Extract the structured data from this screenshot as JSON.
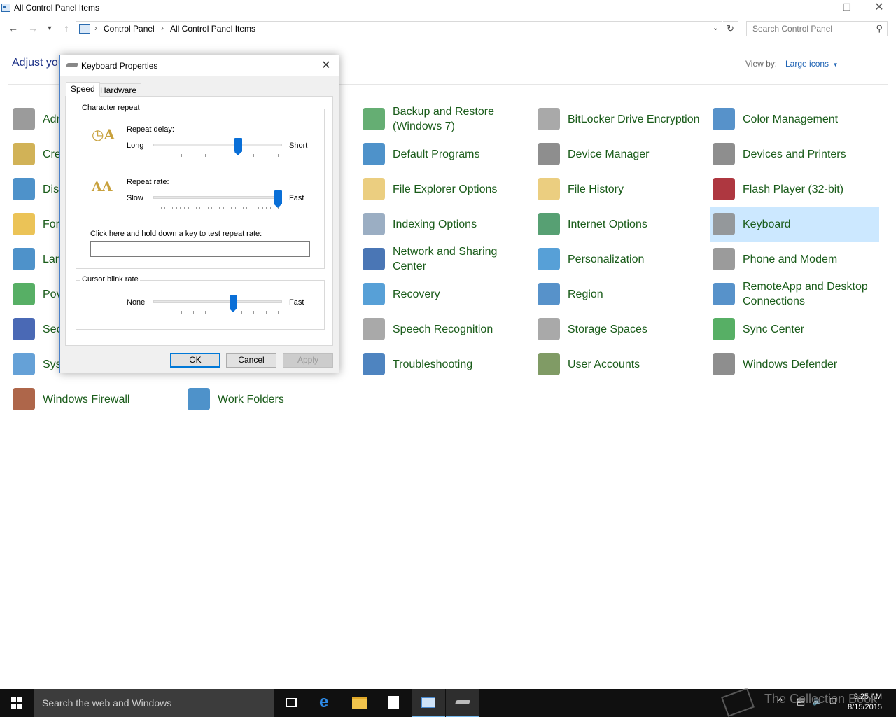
{
  "window": {
    "title": "All Control Panel Items"
  },
  "address": {
    "crumbs": [
      "Control Panel",
      "All Control Panel Items"
    ],
    "search_placeholder": "Search Control Panel"
  },
  "header": {
    "heading_visible": "Adjust you",
    "view_by_label": "View by:",
    "view_by_value": "Large icons"
  },
  "items": [
    {
      "label": "Adr",
      "icon": "administrative-tools-icon",
      "color": "#8a8a8a"
    },
    {
      "label": "Cre",
      "icon": "credential-manager-icon",
      "color": "#c9a43a"
    },
    {
      "label": "Dis",
      "icon": "display-icon",
      "color": "#2f7fc1"
    },
    {
      "label": "For",
      "icon": "fonts-icon",
      "color": "#e8b93a"
    },
    {
      "label": "Lan",
      "icon": "language-icon",
      "color": "#2f7fc1"
    },
    {
      "label": "Pov",
      "icon": "power-options-icon",
      "color": "#3aa14a"
    },
    {
      "label": "Sec",
      "icon": "security-maintenance-icon",
      "color": "#2a4fa8"
    },
    {
      "label": "Sys",
      "icon": "system-icon",
      "color": "#4a90d0"
    },
    {
      "label": "Windows Firewall",
      "icon": "windows-firewall-icon",
      "color": "#a04b2a"
    },
    {
      "label": "Work Folders",
      "icon": "work-folders-icon",
      "color": "#2f7fc1"
    },
    {
      "label": "Backup and Restore (Windows 7)",
      "icon": "backup-restore-icon",
      "color": "#4aa05a"
    },
    {
      "label": "Default Programs",
      "icon": "default-programs-icon",
      "color": "#2f7fc1"
    },
    {
      "label": "File Explorer Options",
      "icon": "file-explorer-options-icon",
      "color": "#e8c66a"
    },
    {
      "label": "Indexing Options",
      "icon": "indexing-options-icon",
      "color": "#8aa0b8"
    },
    {
      "label": "Network and Sharing Center",
      "icon": "network-sharing-icon",
      "color": "#2a5ea8"
    },
    {
      "label": "Recovery",
      "icon": "recovery-icon",
      "color": "#3a8fd0"
    },
    {
      "label": "Speech Recognition",
      "icon": "speech-recognition-icon",
      "color": "#9a9a9a"
    },
    {
      "label": "Troubleshooting",
      "icon": "troubleshooting-icon",
      "color": "#2f6fb5"
    },
    {
      "label": "BitLocker Drive Encryption",
      "icon": "bitlocker-icon",
      "color": "#9a9a9a"
    },
    {
      "label": "Device Manager",
      "icon": "device-manager-icon",
      "color": "#7a7a7a"
    },
    {
      "label": "File History",
      "icon": "file-history-icon",
      "color": "#e8c66a"
    },
    {
      "label": "Internet Options",
      "icon": "internet-options-icon",
      "color": "#3a8f5a"
    },
    {
      "label": "Personalization",
      "icon": "personalization-icon",
      "color": "#3a8fd0"
    },
    {
      "label": "Region",
      "icon": "region-icon",
      "color": "#3a7fc1"
    },
    {
      "label": "Storage Spaces",
      "icon": "storage-spaces-icon",
      "color": "#9a9a9a"
    },
    {
      "label": "User Accounts",
      "icon": "user-accounts-icon",
      "color": "#6a8a4a"
    },
    {
      "label": "Color Management",
      "icon": "color-management-icon",
      "color": "#3a7fc1"
    },
    {
      "label": "Devices and Printers",
      "icon": "devices-printers-icon",
      "color": "#7a7a7a"
    },
    {
      "label": "Flash Player (32-bit)",
      "icon": "flash-player-icon",
      "color": "#a0141e"
    },
    {
      "label": "Keyboard",
      "icon": "keyboard-icon",
      "color": "#8a8a8a"
    },
    {
      "label": "Phone and Modem",
      "icon": "phone-modem-icon",
      "color": "#8a8a8a"
    },
    {
      "label": "RemoteApp and Desktop Connections",
      "icon": "remoteapp-icon",
      "color": "#3a7fc1"
    },
    {
      "label": "Sync Center",
      "icon": "sync-center-icon",
      "color": "#3aa14a"
    },
    {
      "label": "Windows Defender",
      "icon": "windows-defender-icon",
      "color": "#7a7a7a"
    }
  ],
  "dialog": {
    "title": "Keyboard Properties",
    "tabs": [
      "Speed",
      "Hardware"
    ],
    "character_repeat_title": "Character repeat",
    "repeat_delay_label": "Repeat delay:",
    "repeat_delay_min": "Long",
    "repeat_delay_max": "Short",
    "repeat_delay_value": 0.67,
    "repeat_rate_label": "Repeat rate:",
    "repeat_rate_min": "Slow",
    "repeat_rate_max": "Fast",
    "repeat_rate_value": 1.0,
    "test_label": "Click here and hold down a key to test repeat rate:",
    "cursor_blink_title": "Cursor blink rate",
    "cursor_blink_min": "None",
    "cursor_blink_max": "Fast",
    "cursor_blink_value": 0.63,
    "ok": "OK",
    "cancel": "Cancel",
    "apply": "Apply"
  },
  "taskbar": {
    "search_text": "Search the web and Windows",
    "time": "9:25 AM",
    "date": "8/15/2015",
    "watermark": "The Collection Book"
  }
}
